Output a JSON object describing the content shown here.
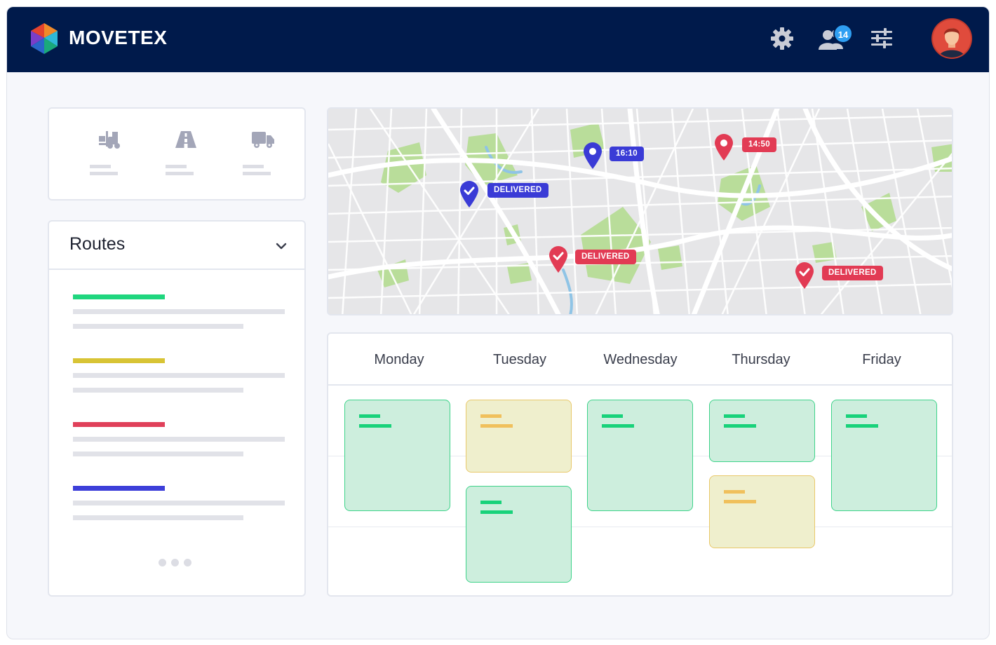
{
  "app": {
    "brand": "MOVETEX",
    "notifications_count": "14"
  },
  "colors": {
    "topbar": "#001a4b",
    "badge": "#2f9ff2",
    "route_green": "#1fd67e",
    "route_yellow": "#d8c435",
    "route_red": "#e0405a",
    "route_blue": "#3d3fd9",
    "block_green": "#cdeedd",
    "block_yellow": "#efefcd"
  },
  "icons": {
    "logo": "movetex-logo-icon",
    "settings": "gear-icon",
    "team": "users-icon",
    "filters": "sliders-icon",
    "profile": "avatar",
    "transport_modes": [
      "forklift-icon",
      "road-icon",
      "truck-icon"
    ]
  },
  "routes": {
    "title": "Routes",
    "items": [
      {
        "color": "#1fd67e"
      },
      {
        "color": "#d8c435"
      },
      {
        "color": "#e0405a"
      },
      {
        "color": "#3d3fd9"
      }
    ]
  },
  "map": {
    "markers": [
      {
        "status": "delivered",
        "label": "DELIVERED",
        "color": "#3a3bd6"
      },
      {
        "status": "pending",
        "label": "16:10",
        "color": "#3a3bd6"
      },
      {
        "status": "pending",
        "label": "14:50",
        "color": "#e23b54"
      },
      {
        "status": "delivered",
        "label": "DELIVERED",
        "color": "#e23b54"
      },
      {
        "status": "delivered",
        "label": "DELIVERED",
        "color": "#e23b54"
      }
    ]
  },
  "calendar": {
    "days": [
      "Monday",
      "Tuesday",
      "Wednesday",
      "Thursday",
      "Friday"
    ],
    "blocks": [
      {
        "day": "Monday",
        "status": "green"
      },
      {
        "day": "Tuesday",
        "status": "yellow"
      },
      {
        "day": "Tuesday",
        "status": "green"
      },
      {
        "day": "Wednesday",
        "status": "green"
      },
      {
        "day": "Thursday",
        "status": "green"
      },
      {
        "day": "Thursday",
        "status": "yellow"
      },
      {
        "day": "Friday",
        "status": "green"
      }
    ]
  }
}
